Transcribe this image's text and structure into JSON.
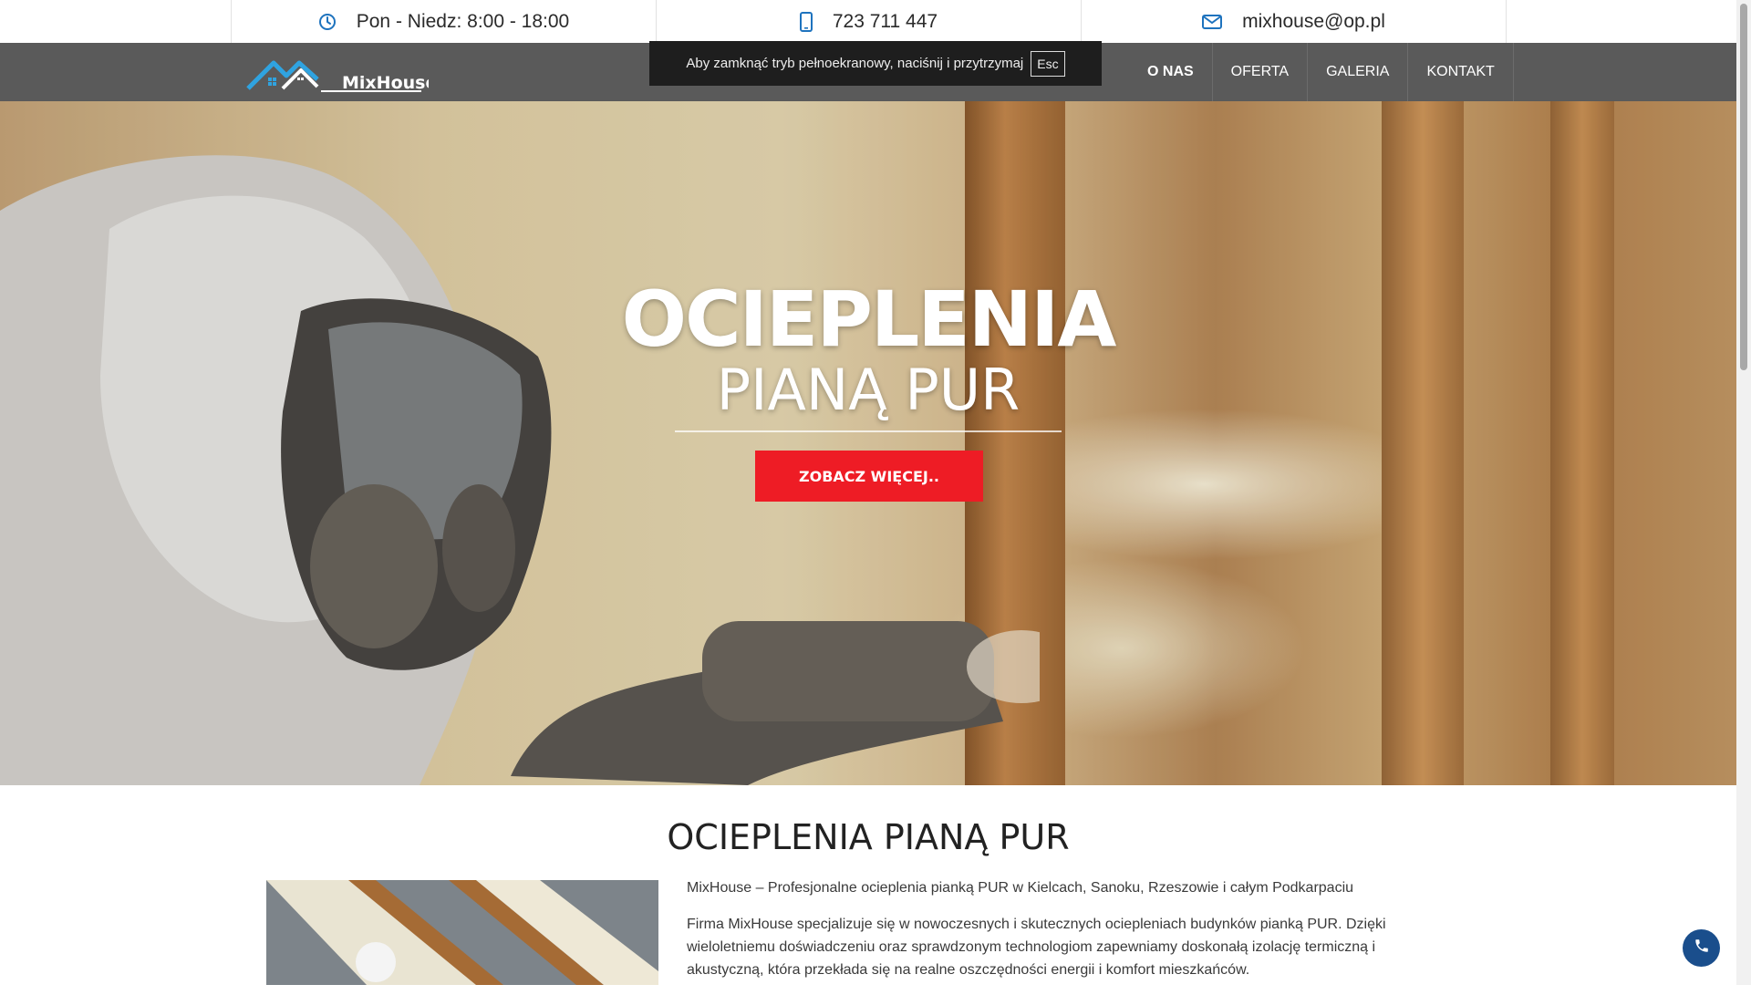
{
  "topbar": {
    "hours": "Pon - Niedz: 8:00 - 18:00",
    "phone": "723 711 447",
    "email": "mixhouse@op.pl"
  },
  "header": {
    "logo_text": "MixHouse",
    "nav": [
      {
        "label": "O NAS",
        "active": true
      },
      {
        "label": "OFERTA",
        "active": false
      },
      {
        "label": "GALERIA",
        "active": false
      },
      {
        "label": "KONTAKT",
        "active": false
      }
    ]
  },
  "fullscreen_notice": {
    "text": "Aby zamknąć tryb pełnoekranowy, naciśnij i przytrzymaj",
    "key": "Esc"
  },
  "hero": {
    "title": "OCIEPLENIA",
    "subtitle": "PIANĄ PUR",
    "button": "ZOBACZ WIĘCEJ.."
  },
  "about": {
    "title": "OCIEPLENIA PIANĄ PUR",
    "paragraph1": "MixHouse – Profesjonalne ocieplenia pianką PUR w Kielcach, Sanoku, Rzeszowie i całym Podkarpaciu",
    "paragraph2": "Firma MixHouse specjalizuje się w nowoczesnych i skutecznych ociepleniach budynków pianką PUR. Dzięki wieloletniemu doświadczeniu oraz sprawdzonym technologiom zapewniamy doskonałą izolację termiczną i akustyczną, która przekłada się na realne oszczędności energii i komfort mieszkańców."
  },
  "colors": {
    "accent_red": "#ee1c25",
    "nav_bg": "#5a5a5a",
    "icon_blue": "#1e73be",
    "fab_blue": "#1a4e8c"
  }
}
